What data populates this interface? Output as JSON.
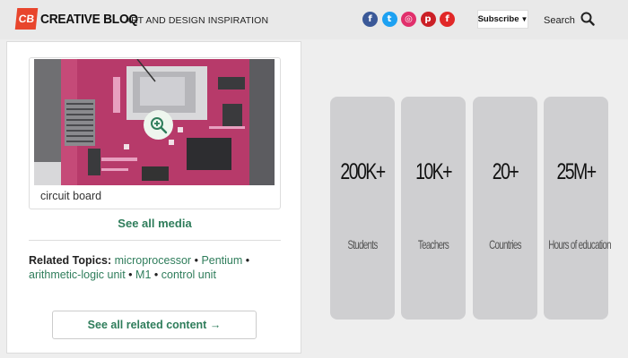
{
  "header": {
    "logo_badge": "CB",
    "logo_name": "CREATIVE BLOQ",
    "tagline": "ART AND DESIGN INSPIRATION",
    "social_icons": [
      {
        "name": "facebook-icon",
        "glyph": "f",
        "color": "#3b5998"
      },
      {
        "name": "twitter-icon",
        "glyph": "t",
        "color": "#1da1f2"
      },
      {
        "name": "instagram-icon",
        "glyph": "◎",
        "color": "#e1306c"
      },
      {
        "name": "pinterest-icon",
        "glyph": "p",
        "color": "#cb2027"
      },
      {
        "name": "flipboard-icon",
        "glyph": "f",
        "color": "#e12828"
      }
    ],
    "subscribe_label": "Subscribe",
    "subscribe_arrow": "▼",
    "search_label": "Search"
  },
  "card": {
    "media_caption": "circuit board",
    "see_all_media": "See all media",
    "related_label": "Related Topics:",
    "related_topics": [
      "microprocessor",
      "Pentium",
      "arithmetic-logic unit",
      "M1",
      "control unit"
    ],
    "separator": "•",
    "see_all_related": "See all related content →"
  },
  "stats": [
    {
      "value": "200K+",
      "label": "Students"
    },
    {
      "value": "10K+",
      "label": "Teachers"
    },
    {
      "value": "20+",
      "label": "Countries"
    },
    {
      "value": "25M+",
      "label": "Hours of education"
    }
  ],
  "colors": {
    "accent_green": "#2f7d5b",
    "logo_red": "#e8452c",
    "tile_gray": "#cfcfd1"
  }
}
